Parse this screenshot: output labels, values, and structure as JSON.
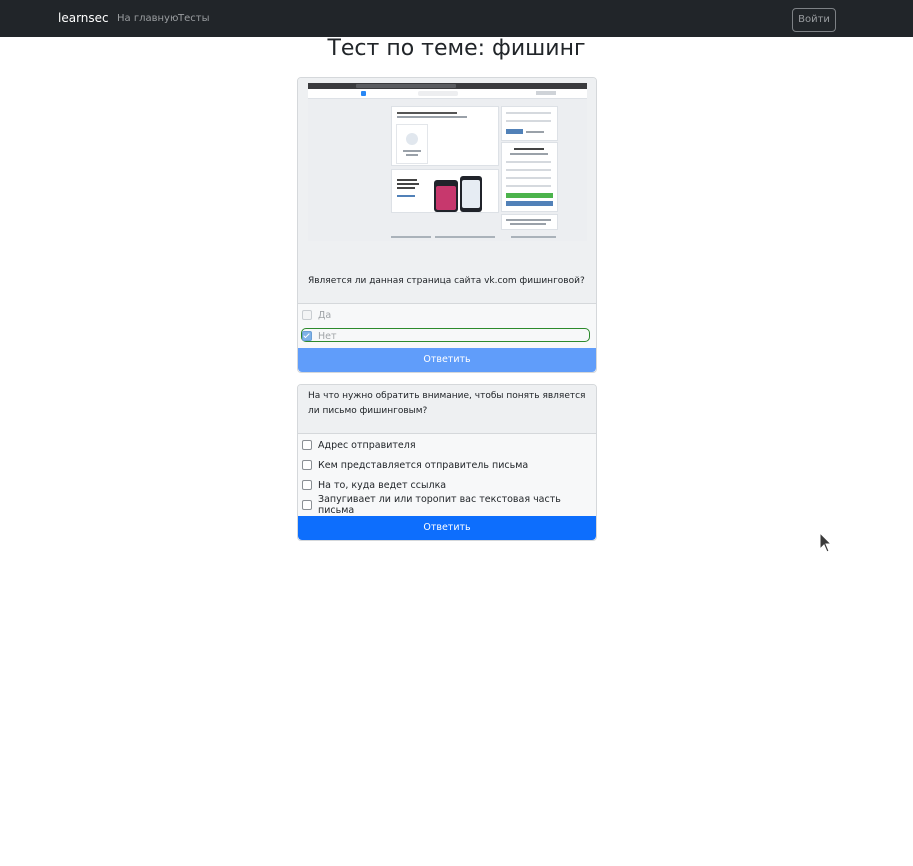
{
  "navbar": {
    "brand": "learnsec",
    "links": [
      "На главную",
      "Тесты"
    ],
    "login_label": "Войти"
  },
  "page": {
    "title": "Тест по теме: фишинг"
  },
  "questions": [
    {
      "text": "Является ли данная страница сайта vk.com фишинговой?",
      "image_icon": "vk-login-page-screenshot",
      "options": [
        {
          "label": "Да",
          "checked": false,
          "disabled": true
        },
        {
          "label": "Нет",
          "checked": true,
          "disabled": true
        }
      ],
      "submit_label": "Ответить",
      "submit_disabled": true
    },
    {
      "text": "На что нужно обратить внимание, чтобы понять является ли письмо фишинговым?",
      "options": [
        {
          "label": "Адрес отправителя",
          "checked": false
        },
        {
          "label": "Кем представляется отправитель письма",
          "checked": false
        },
        {
          "label": "На то, куда ведет ссылка",
          "checked": false
        },
        {
          "label": "Запугивает ли или торопит вас текстовая часть письма",
          "checked": false
        }
      ],
      "submit_label": "Ответить",
      "submit_disabled": false
    }
  ],
  "colors": {
    "navbar_bg": "#212529",
    "primary": "#0d6efd",
    "primary_disabled": "#609dfa",
    "selected_outline": "#2c8a2c"
  }
}
